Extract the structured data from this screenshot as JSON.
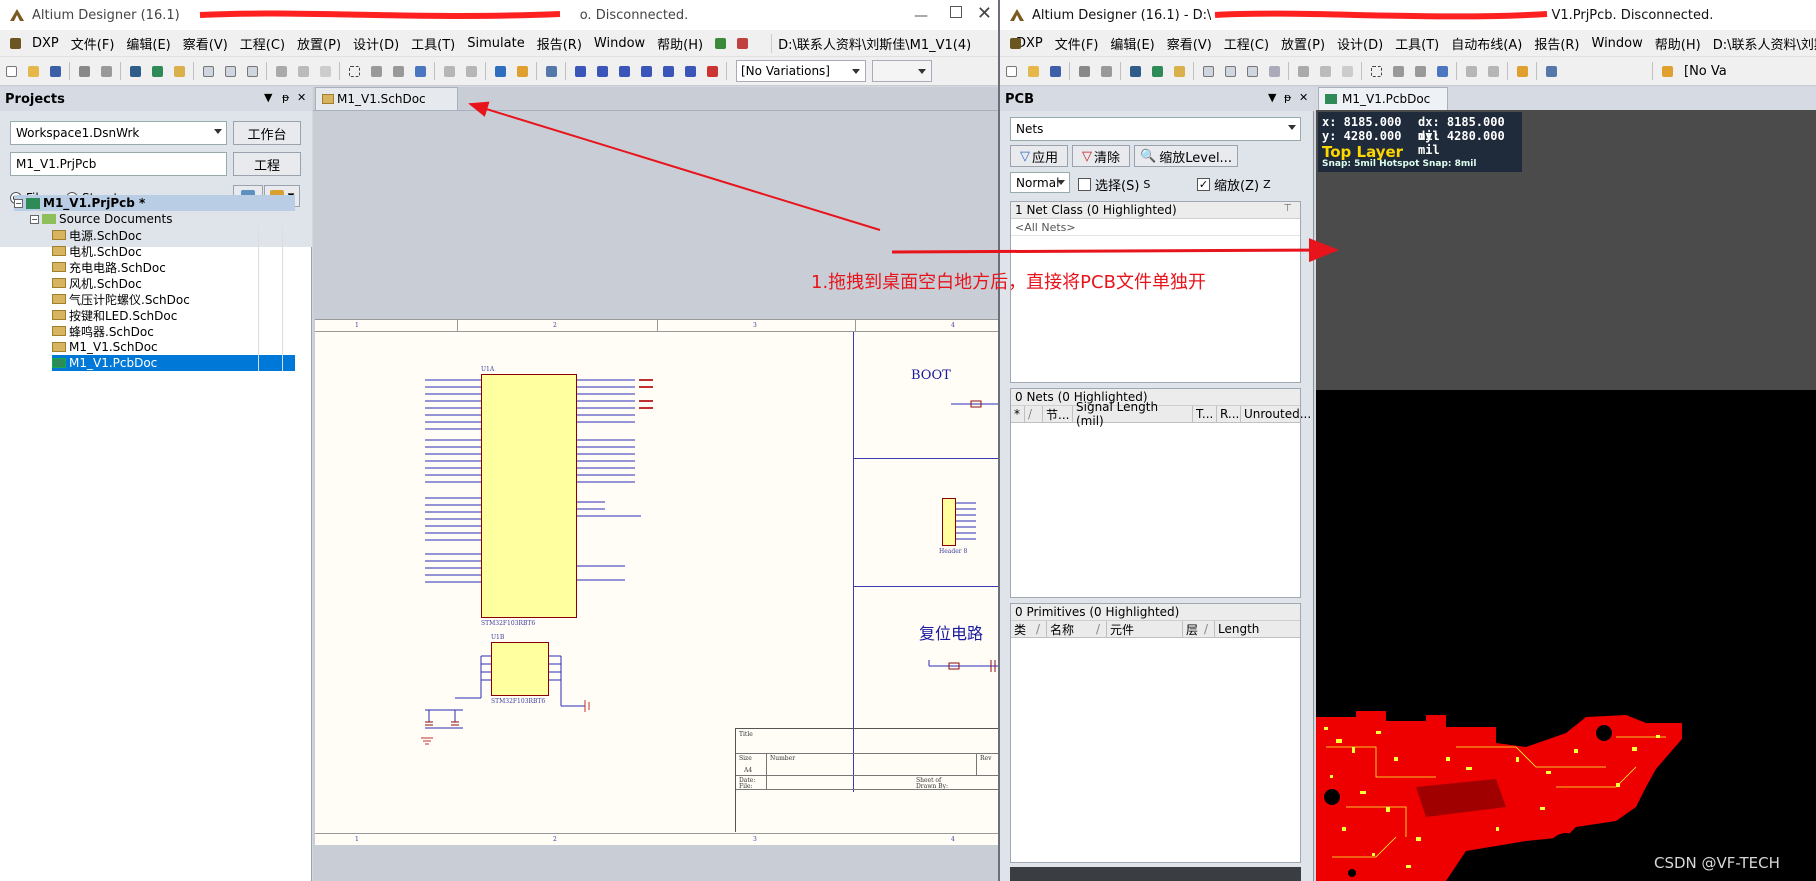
{
  "left_window": {
    "title": "Altium Designer (16.1) - D:\\...\\M1_V1.PrjPcb. Disconnected.",
    "title_visible_prefix": "Altium Designer (16.1)",
    "title_visible_suffix": "o. Disconnected.",
    "menu": [
      "DXP",
      "文件(F)",
      "编辑(E)",
      "察看(V)",
      "工程(C)",
      "放置(P)",
      "设计(D)",
      "工具(T)",
      "Simulate",
      "报告(R)",
      "Window",
      "帮助(H)"
    ],
    "path_combo": "D:\\联系人资料\\刘斯佳\\M1_V1(4)",
    "variations": "[No Variations]",
    "projects_panel": {
      "title": "Projects",
      "workspace": "Workspace1.DsnWrk",
      "workspace_button": "工作台",
      "project": "M1_V1.PrjPcb",
      "project_button": "工程",
      "radio_files": "Files",
      "radio_structure": "Structure",
      "tree_root": "M1_V1.PrjPcb *",
      "tree_folder": "Source Documents",
      "documents": [
        "电源.SchDoc",
        "电机.SchDoc",
        "充电电路.SchDoc",
        "风机.SchDoc",
        "气压计陀螺仪.SchDoc",
        "按键和LED.SchDoc",
        "蜂鸣器.SchDoc",
        "M1_V1.SchDoc",
        "M1_V1.PcbDoc"
      ]
    },
    "doc_tab": "M1_V1.SchDoc",
    "schematic": {
      "col_labels": [
        "1",
        "2",
        "3",
        "4"
      ],
      "boot_label": "BOOT",
      "reset_label": "复位电路",
      "mcu_name": "STM32F103RBT6",
      "mcu_ref": "U1A",
      "mcu2_ref": "U1B",
      "header_label": "Header 8",
      "title_block": {
        "title": "Title",
        "size": "Size",
        "number": "Number",
        "rev": "Rev",
        "size_val": "A4",
        "date": "Date:",
        "file": "File:",
        "sheet": "Sheet  of",
        "drawn": "Drawn By:"
      }
    }
  },
  "right_window": {
    "title_visible_prefix": "Altium Designer (16.1) - D:\\",
    "title_visible_suffix": "V1.PrjPcb. Disconnected.",
    "menu": [
      "DXP",
      "文件(F)",
      "编辑(E)",
      "察看(V)",
      "工程(C)",
      "放置(P)",
      "设计(D)",
      "工具(T)",
      "自动布线(A)",
      "报告(R)",
      "Window",
      "帮助(H)"
    ],
    "path_combo": "D:\\联系人资料\\刘斯",
    "variations": "[No Va",
    "pcb_panel": {
      "title": "PCB",
      "mode": "Nets",
      "apply": "应用",
      "clear": "清除",
      "zoom_level": "缩放Level...",
      "normal": "Normal",
      "select_label": "选择(S)",
      "select_key": "S",
      "zoom_label": "缩放(Z)",
      "zoom_key": "Z",
      "net_class_header": "1 Net Class (0 Highlighted)",
      "all_nets": "<All Nets>",
      "nets_header": "0 Nets (0 Highlighted)",
      "nets_columns": [
        "*",
        "/",
        "节...",
        "Signal Length (mil)",
        "T...",
        "R...",
        "Unrouted..."
      ],
      "primitives_header": "0 Primitives (0 Highlighted)",
      "primitives_columns": [
        "类",
        "/",
        "名称",
        "/",
        "元件",
        "层",
        "/",
        "Length"
      ]
    },
    "doc_tab": "M1_V1.PcbDoc",
    "hud": {
      "x": "x:  8185.000",
      "dx": "dx:  8185.000  mil",
      "y": "y:  4280.000",
      "dy": "dy:  4280.000  mil",
      "layer": "Top Layer",
      "snap": "Snap: 5mil Hotspot Snap: 8mil"
    }
  },
  "annotation": {
    "text": "1.拖拽到桌面空白地方后，直接将PCB文件单独开",
    "color": "#e8141c"
  },
  "watermark": "CSDN @VF-TECH"
}
